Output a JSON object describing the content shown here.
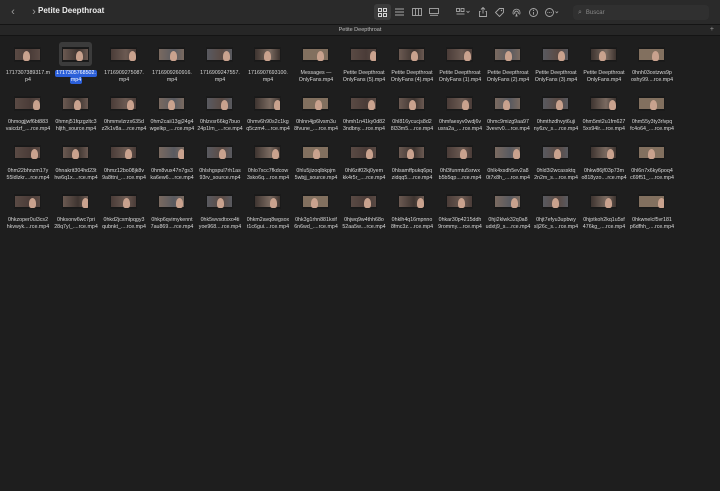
{
  "window": {
    "title": "Petite Deepthroat",
    "path_title": "Petite Deepthroat",
    "back_icon": "chevron-left-icon",
    "forward_icon": "chevron-right-icon"
  },
  "search": {
    "placeholder": "Buscar"
  },
  "toolbar": {
    "view_modes": [
      "icon-view-icon",
      "list-view-icon",
      "column-view-icon",
      "gallery-view-icon"
    ],
    "active_view": "icon-view-icon",
    "actions": [
      "group-by-icon",
      "share-icon",
      "tag-icon",
      "airdrop-icon",
      "info-icon",
      "more-icon"
    ]
  },
  "files": [
    {
      "line1": "1717307389317.m",
      "line2": "p4"
    },
    {
      "line1": "1717305768502.",
      "line2": "mp4",
      "selected": true
    },
    {
      "line1": "1716909275087.",
      "line2": "mp4"
    },
    {
      "line1": "1716909260916.",
      "line2": "mp4"
    },
    {
      "line1": "1716909247557.",
      "line2": "mp4"
    },
    {
      "line1": "1716907693100.",
      "line2": "mp4"
    },
    {
      "line1": "Messages —",
      "line2": "OnlyFans.mp4"
    },
    {
      "line1": "Petite Deepthroat",
      "line2": "OnlyFans (5).mp4"
    },
    {
      "line1": "Petite Deepthroat",
      "line2": "OnlyFans (4).mp4"
    },
    {
      "line1": "Petite Deepthroat",
      "line2": "OnlyFans (1).mp4"
    },
    {
      "line1": "Petite Deepthroat",
      "line2": "OnlyFans (2).mp4"
    },
    {
      "line1": "Petite Deepthroat",
      "line2": "OnlyFans (3).mp4"
    },
    {
      "line1": "Petite Deepthroat",
      "line2": "OnlyFans.mp4"
    },
    {
      "line1": "0hnh03oxtzws9p",
      "line2": "oshy99....rce.mp4"
    },
    {
      "line1": "0hmogjjwf6bt883",
      "line2": "vaicdzf_....rce.mp4"
    },
    {
      "line1": "0hmnj51fqzgzltc3",
      "line2": "hljth_source.mp4"
    },
    {
      "line1": "0hmmvlzrzx635d",
      "line2": "z2k1v8a....rce.mp4"
    },
    {
      "line1": "0hm2caii13gj24g4",
      "line2": "wgelkp_....rce.mp4"
    },
    {
      "line1": "0hlzvsr66kg7buo",
      "line2": "24p1lm_....rce.mp4"
    },
    {
      "line1": "0hmv6h90s2c1kg",
      "line2": "q5czm4....rce.mp4"
    },
    {
      "line1": "0hlnn4jp6lvsm3u",
      "line2": "8fvune_....rce.mp4"
    },
    {
      "line1": "0hmh1n41ky0d82",
      "line2": "3ndbny....rce.mp4"
    },
    {
      "line1": "0hl816ycucjs8d2",
      "line2": "8l33m5....rce.mp4"
    },
    {
      "line1": "0hmfaesyv0wdj6v",
      "line2": "usra2a_....rce.mp4"
    },
    {
      "line1": "0hmc9mizg9aa97",
      "line2": "3vevrv0....rce.mp4"
    },
    {
      "line1": "0hmthzdhvyt6uji",
      "line2": "ny6zv_s....rce.mp4"
    },
    {
      "line1": "0hm5mt2u1fm627",
      "line2": "5xx94lr....rce.mp4"
    },
    {
      "line1": "0hm55y3ty3rlvpq",
      "line2": "fc4o64_....rce.mp4"
    },
    {
      "line1": "0hm22bhnzm17y",
      "line2": "55ldlzkr....rce.mp4"
    },
    {
      "line1": "0hnakrit304hd23t",
      "line2": "hw6q1x....rce.mp4"
    },
    {
      "line1": "0hmz12bo08jk8v",
      "line2": "9a8ttni_....rce.mp4"
    },
    {
      "line1": "0hm8vux47n7gs3",
      "line2": "ka6ew6....rce.mp4"
    },
    {
      "line1": "0hlshgspul7rh1as",
      "line2": "93rv_source.mp4"
    },
    {
      "line1": "0hlo7xcc7fkdcow",
      "line2": "3sko6q....rce.mp4"
    },
    {
      "line1": "0hlu5jizoqlbkpjm",
      "line2": "5wbjj_source.mp4"
    },
    {
      "line1": "0hl6zif02kj0yem",
      "line2": "kk4r5r_....rce.mp4"
    },
    {
      "line1": "0hlsamffpukq6pq",
      "line2": "zidqq5....rce.mp4"
    },
    {
      "line1": "0hl3funmtu5srwx",
      "line2": "b5b5qp....rce.mp4"
    },
    {
      "line1": "0hlk4xsdh5ev2a8",
      "line2": "0t7x8h_....rce.mp4"
    },
    {
      "line1": "0hld3i2wcassktq",
      "line2": "2n2m_s....rce.mp4"
    },
    {
      "line1": "0hkw86jf03p73m",
      "line2": "o818yzo....rce.mp4"
    },
    {
      "line1": "0hl6n7x6ky6poq4",
      "line2": "c69f51_....rce.mp4"
    },
    {
      "line1": "0hkzoper0ul3cs2",
      "line2": "hkvwyk....rce.mp4"
    },
    {
      "line1": "0hksorw6wc7pri",
      "line2": "28q7yl_....rce.mp4"
    },
    {
      "line1": "0hkd2jcxmlpqgy3",
      "line2": "qubnkt_....rce.mp4"
    },
    {
      "line1": "0hkp6qvimykennt",
      "line2": "7au869....rce.mp4"
    },
    {
      "line1": "0hk5wvsdtxxo4ti",
      "line2": "yoe968....rce.mp4"
    },
    {
      "line1": "0hkm2avq8wgsox",
      "line2": "t1c6gui....rce.mp4"
    },
    {
      "line1": "0hk3g1rhn881kxif",
      "line2": "6n6wd_....rce.mp4"
    },
    {
      "line1": "0hjwq9w4thh68o",
      "line2": "52aa5w....rce.mp4"
    },
    {
      "line1": "0hklh4q16mpnno",
      "line2": "8fmc3z....rce.mp4"
    },
    {
      "line1": "0hkar30p4215ddh",
      "line2": "9rommy....rce.mp4"
    },
    {
      "line1": "0hji2klwk32q0a8",
      "line2": "udxtj9_s....rce.mp4"
    },
    {
      "line1": "0hjt7efyu3upbwy",
      "line2": "slj26c_s....rce.mp4"
    },
    {
      "line1": "0hjptkoh2kq1u5sf",
      "line2": "476kg_....rce.mp4"
    },
    {
      "line1": "0hkwnelcf5vr181",
      "line2": "p6dfhh_....rce.mp4"
    }
  ],
  "thumb_palette": [
    "#5a4a44",
    "#6b5a52",
    "#4a3c38",
    "#7a6a60",
    "#595a60",
    "#3e3430",
    "#82705f"
  ]
}
